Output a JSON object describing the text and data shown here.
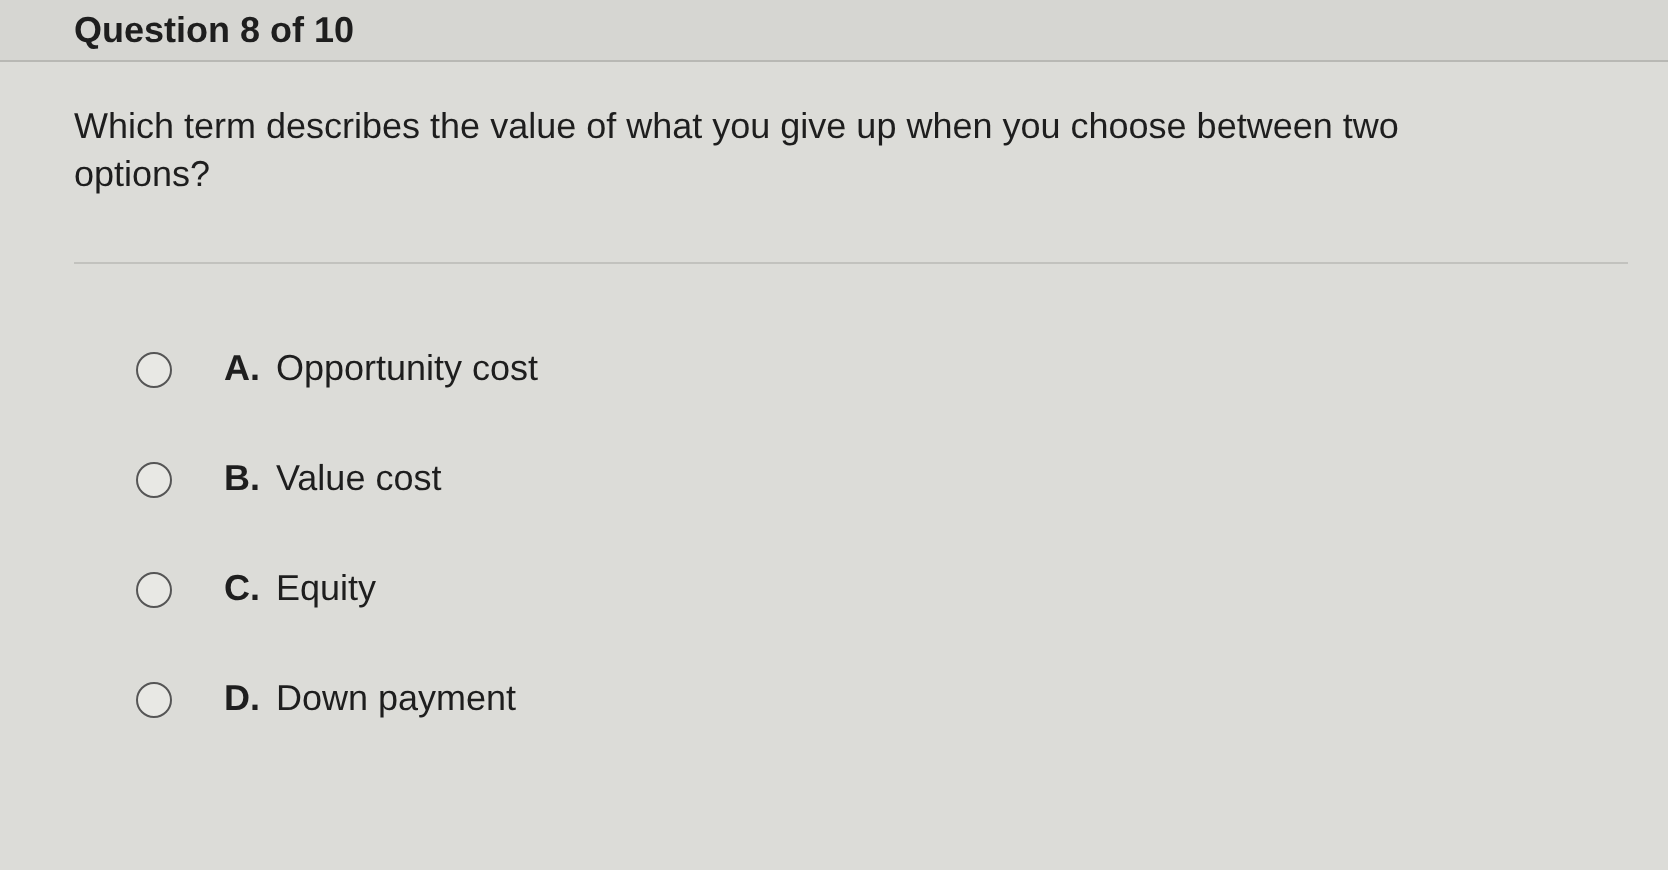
{
  "header": {
    "title": "Question 8 of 10"
  },
  "question": {
    "text": "Which term describes the value of what you give up when you choose between two options?"
  },
  "options": [
    {
      "letter": "A.",
      "label": "Opportunity cost",
      "selected": false
    },
    {
      "letter": "B.",
      "label": "Value cost",
      "selected": false
    },
    {
      "letter": "C.",
      "label": "Equity",
      "selected": false
    },
    {
      "letter": "D.",
      "label": "Down payment",
      "selected": false
    }
  ]
}
